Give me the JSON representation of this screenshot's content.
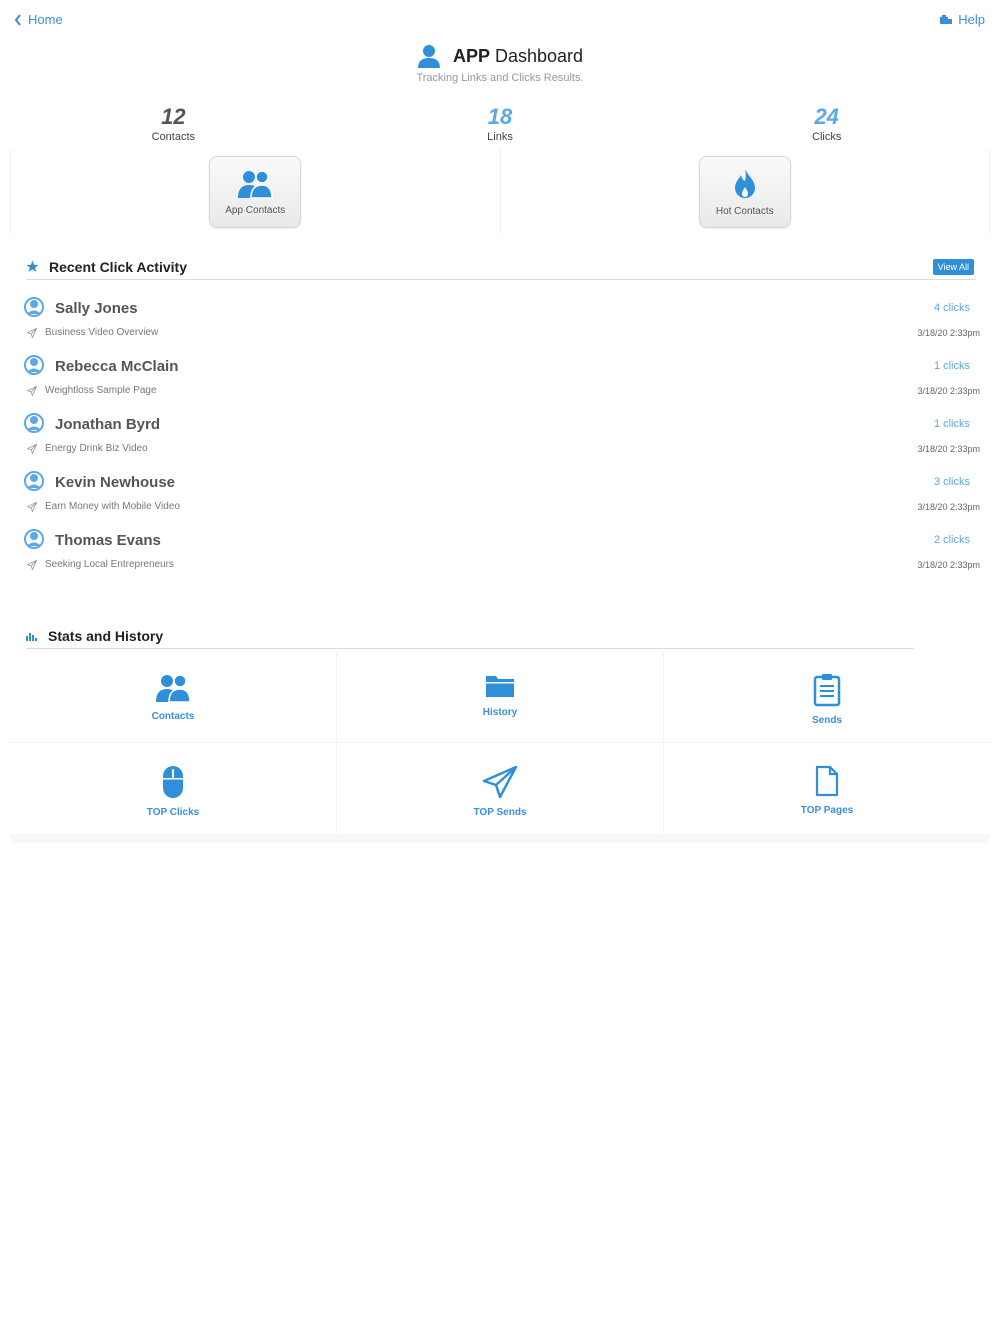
{
  "nav": {
    "back_label": "Home",
    "help_label": "Help"
  },
  "header": {
    "title_bold": "APP",
    "title_rest": "Dashboard",
    "subtitle": "Tracking Links and Clicks Results."
  },
  "stats": [
    {
      "value": "12",
      "label": "Contacts",
      "color": "#555555"
    },
    {
      "value": "18",
      "label": "Links",
      "color": "#5aa9e6"
    },
    {
      "value": "24",
      "label": "Clicks",
      "color": "#5aa9e6"
    }
  ],
  "tiles": {
    "app_contacts": "App Contacts",
    "hot_contacts": "Hot Contacts"
  },
  "recent": {
    "title": "Recent Click Activity",
    "view_all": "View All",
    "items": [
      {
        "name": "Sally Jones",
        "clicks": "4 clicks",
        "page": "Business Video Overview",
        "time": "3/18/20 2:33pm"
      },
      {
        "name": "Rebecca McClain",
        "clicks": "1 clicks",
        "page": "Weightloss Sample Page",
        "time": "3/18/20 2:33pm"
      },
      {
        "name": "Jonathan Byrd",
        "clicks": "1 clicks",
        "page": "Energy Drink Biz Video",
        "time": "3/18/20 2:33pm"
      },
      {
        "name": "Kevin Newhouse",
        "clicks": "3 clicks",
        "page": "Earn Money with Mobile Video",
        "time": "3/18/20 2:33pm"
      },
      {
        "name": "Thomas Evans",
        "clicks": "2 clicks",
        "page": "Seeking Local Entrepreneurs",
        "time": "3/18/20 2:33pm"
      }
    ]
  },
  "stats_history": {
    "title": "Stats and History",
    "items": [
      "Contacts",
      "History",
      "Sends",
      "TOP Clicks",
      "TOP Sends",
      "TOP Pages"
    ]
  },
  "colors": {
    "accent": "#3a8fd6",
    "accent_light": "#5aa9e6",
    "icon_blue": "#2f8fd8"
  }
}
